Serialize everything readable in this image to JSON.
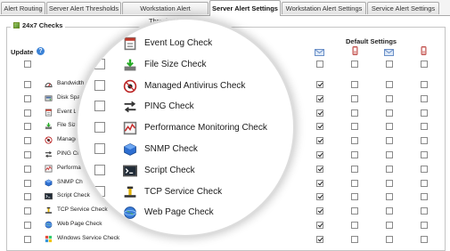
{
  "tabs": [
    {
      "label": "Alert Routing",
      "active": false
    },
    {
      "label": "Server Alert Thresholds",
      "active": false
    },
    {
      "label": "Workstation Alert Thresholds",
      "active": false
    },
    {
      "label": "Server Alert Settings",
      "active": true
    },
    {
      "label": "Workstation Alert Settings",
      "active": false
    },
    {
      "label": "Service Alert Settings",
      "active": false
    }
  ],
  "section": {
    "title": "24x7 Checks",
    "update_label": "Update",
    "default_settings_label": "Default Settings"
  },
  "columns": [
    {
      "icon": "email-icon",
      "color": "#6a8fc7"
    },
    {
      "icon": "phone-icon",
      "color": "#c0504d"
    },
    {
      "icon": "email-icon",
      "color": "#6a8fc7"
    },
    {
      "icon": "phone-icon",
      "color": "#c0504d"
    }
  ],
  "rows": [
    {
      "label": "Bandwidth Monitoring Check",
      "icon": "bandwidth-icon",
      "checks": [
        true,
        false,
        false,
        false
      ]
    },
    {
      "label": "Disk Space Check",
      "icon": "disk-icon",
      "checks": [
        true,
        false,
        false,
        false
      ]
    },
    {
      "label": "Event Log Check",
      "icon": "event-log-icon",
      "checks": [
        true,
        false,
        false,
        false
      ]
    },
    {
      "label": "File Size Check",
      "icon": "file-size-icon",
      "checks": [
        true,
        false,
        false,
        false
      ]
    },
    {
      "label": "Managed Antivirus Check",
      "icon": "antivirus-icon",
      "checks": [
        true,
        false,
        false,
        false
      ]
    },
    {
      "label": "PING Check",
      "icon": "ping-icon",
      "checks": [
        true,
        false,
        false,
        false
      ]
    },
    {
      "label": "Performance Monitoring Check",
      "icon": "performance-icon",
      "checks": [
        true,
        false,
        false,
        false
      ]
    },
    {
      "label": "SNMP Check",
      "icon": "snmp-icon",
      "checks": [
        true,
        false,
        false,
        false
      ]
    },
    {
      "label": "Script Check",
      "icon": "script-icon",
      "checks": [
        true,
        false,
        false,
        false
      ]
    },
    {
      "label": "TCP Service Check",
      "icon": "tcp-icon",
      "checks": [
        true,
        false,
        false,
        false
      ]
    },
    {
      "label": "Web Page Check",
      "icon": "web-page-icon",
      "checks": [
        true,
        false,
        false,
        false
      ]
    },
    {
      "label": "Windows Service Check",
      "icon": "windows-service-icon",
      "checks": [
        true,
        false,
        false,
        false
      ]
    }
  ],
  "visible_small_labels": [
    "Bandwidth M",
    "Disk Space",
    "Event Lo",
    "File Size",
    "Managed",
    "PING Ch",
    "Performa",
    "SNMP Ch",
    "Script Check",
    "TCP Service Check",
    "Web Page Check",
    "Windows Service Check"
  ],
  "magnifier": {
    "items": [
      {
        "label": "Event Log Check",
        "icon": "event-log-icon"
      },
      {
        "label": "File Size Check",
        "icon": "file-size-icon"
      },
      {
        "label": "Managed Antivirus Check",
        "icon": "antivirus-icon"
      },
      {
        "label": "PING Check",
        "icon": "ping-icon"
      },
      {
        "label": "Performance Monitoring Check",
        "icon": "performance-icon"
      },
      {
        "label": "SNMP Check",
        "icon": "snmp-icon"
      },
      {
        "label": "Script Check",
        "icon": "script-icon"
      },
      {
        "label": "TCP Service Check",
        "icon": "tcp-icon"
      },
      {
        "label": "Web Page Check",
        "icon": "web-page-icon"
      }
    ]
  }
}
